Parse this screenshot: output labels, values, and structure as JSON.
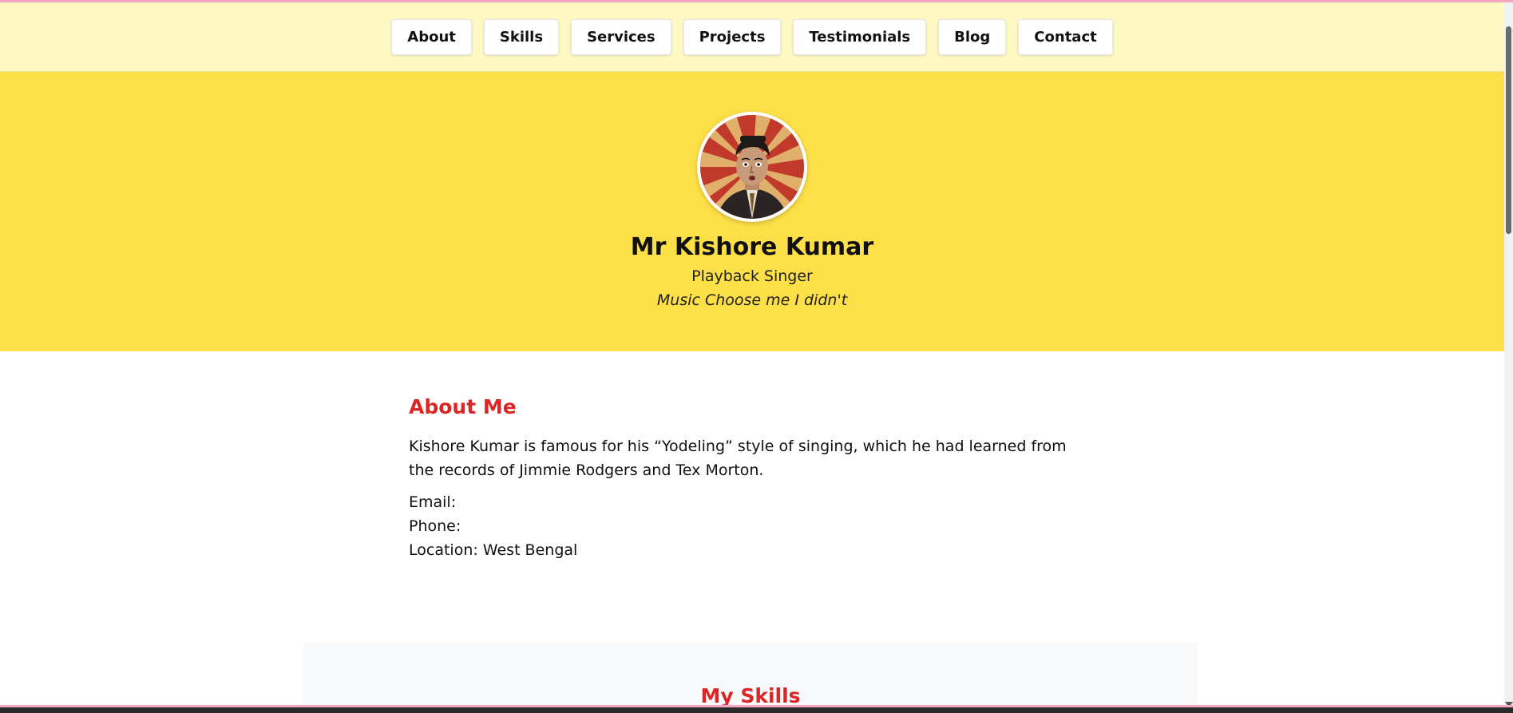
{
  "nav": {
    "items": [
      {
        "label": "About"
      },
      {
        "label": "Skills"
      },
      {
        "label": "Services"
      },
      {
        "label": "Projects"
      },
      {
        "label": "Testimonials"
      },
      {
        "label": "Blog"
      },
      {
        "label": "Contact"
      }
    ]
  },
  "hero": {
    "name": "Mr Kishore Kumar",
    "title": "Playback Singer",
    "tagline": "Music Choose me I didn't"
  },
  "about": {
    "heading": "About Me",
    "text": "Kishore Kumar is famous for his “Yodeling” style of singing, which he had learned from the records of Jimmie Rodgers and Tex Morton.",
    "email_line": "Email:",
    "phone_line": "Phone:",
    "location_line": "Location: West Bengal"
  },
  "skills": {
    "heading": "My Skills"
  },
  "colors": {
    "nav_bg": "#fef9c3",
    "hero_bg": "#fde047",
    "heading_red": "#dc2626"
  }
}
